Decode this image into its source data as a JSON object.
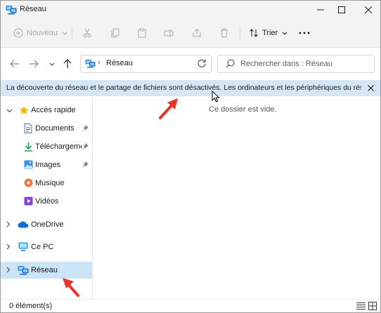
{
  "window": {
    "title": "Réseau"
  },
  "commandbar": {
    "new_label": "Nouveau",
    "sort_label": "Trier"
  },
  "address": {
    "location": "Réseau",
    "search_placeholder": "Rechercher dans : Réseau"
  },
  "infobar": {
    "message": "La découverte du réseau et le partage de fichiers sont désactivés. Les ordinateurs et les périphériques du réseau ne so..."
  },
  "navigation": {
    "quick_access": "Accès rapide",
    "items": [
      {
        "label": "Documents"
      },
      {
        "label": "Téléchargements"
      },
      {
        "label": "Images"
      },
      {
        "label": "Musique"
      },
      {
        "label": "Vidéos"
      }
    ],
    "onedrive": "OneDrive",
    "this_pc": "Ce PC",
    "network": "Réseau"
  },
  "content": {
    "empty_message": "Ce dossier est vide."
  },
  "statusbar": {
    "item_count": "0 élément(s)"
  },
  "colors": {
    "selection": "#cce4f7",
    "infobar": "#d6e6f5",
    "annotation_arrow": "#e8352a",
    "accent": "#0067c0"
  },
  "icons": [
    "network-icon",
    "new-icon",
    "cut-icon",
    "copy-icon",
    "paste-icon",
    "rename-icon",
    "share-icon",
    "delete-icon",
    "sort-icon",
    "more-icon",
    "star-icon",
    "pin-icon",
    "cloud-icon",
    "monitor-icon"
  ]
}
